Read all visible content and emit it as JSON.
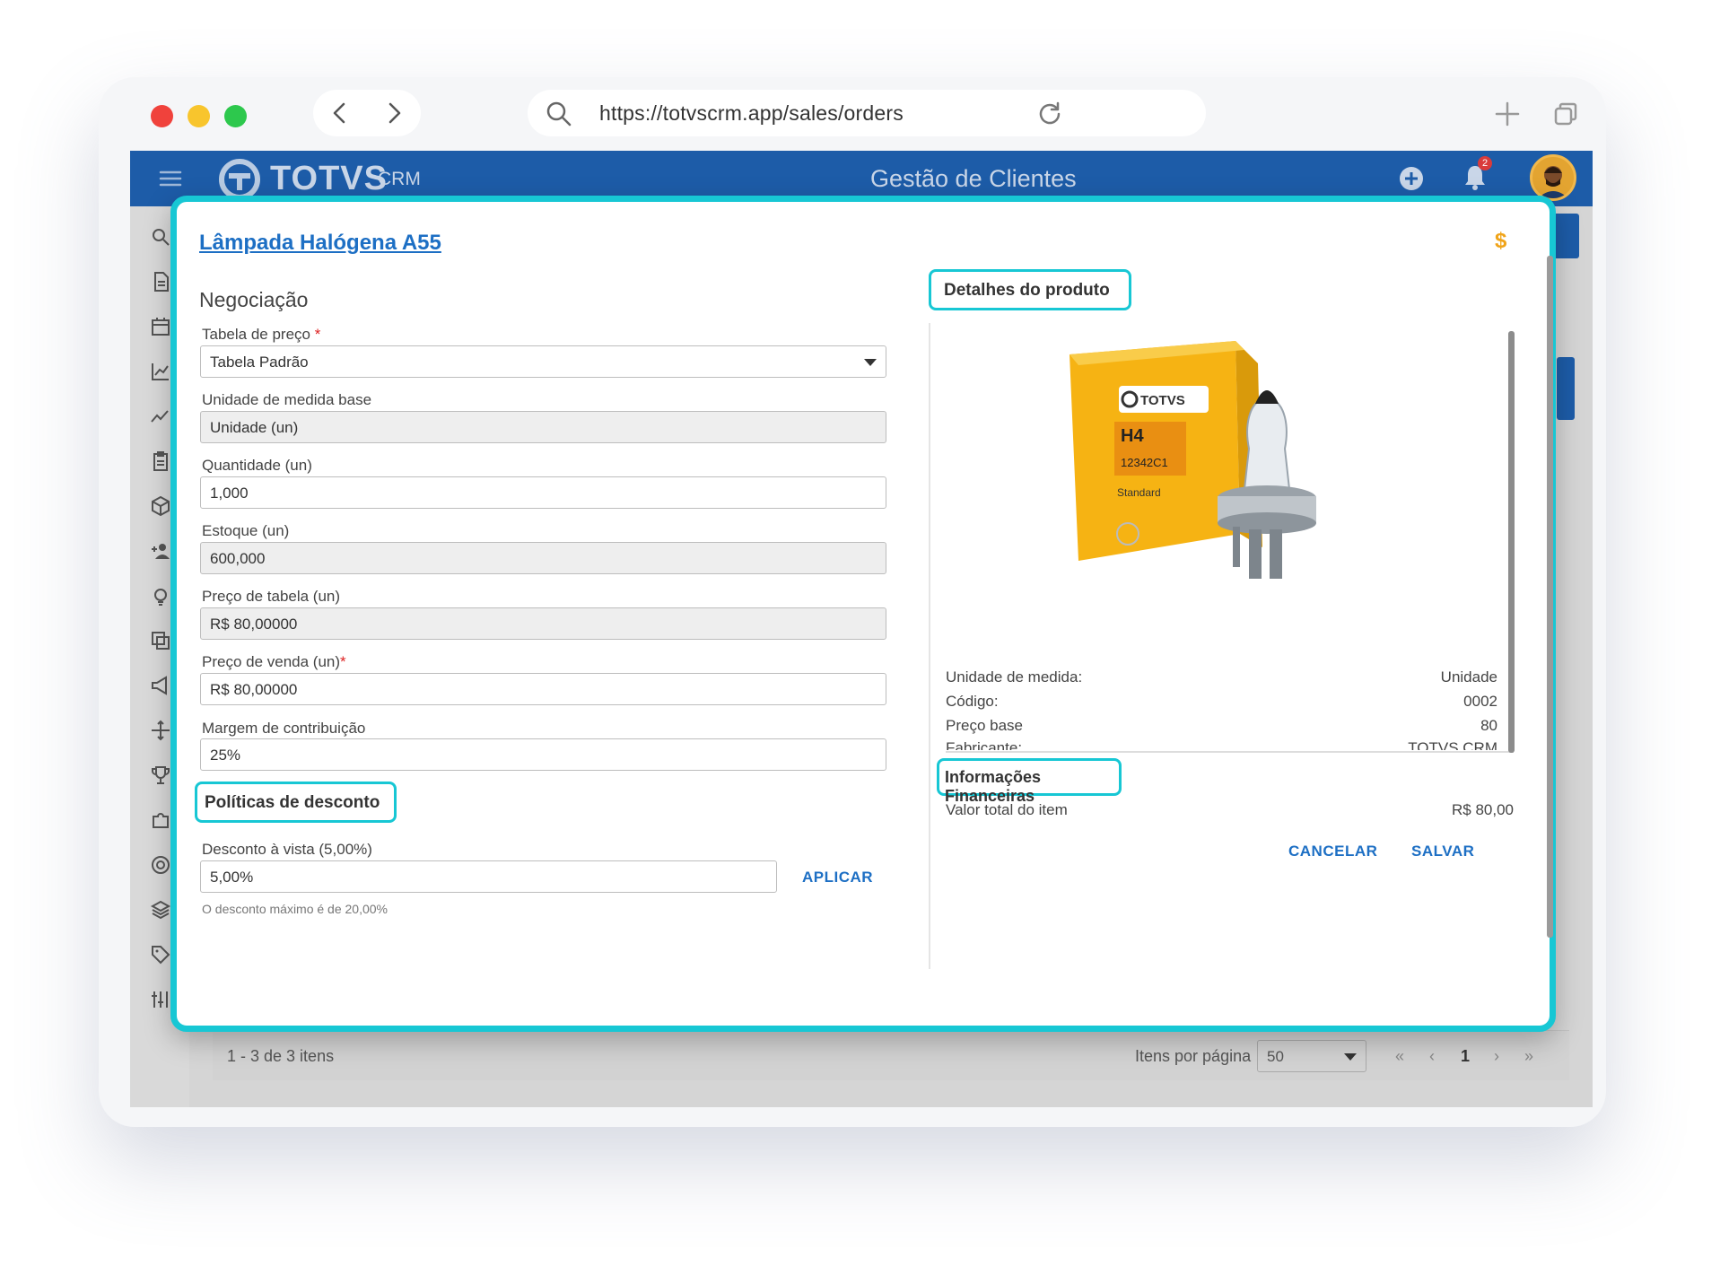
{
  "browser": {
    "url": "https://totvscrm.app/sales/orders",
    "traffic_colors": [
      "#f0423c",
      "#f8c52d",
      "#2dc84d"
    ]
  },
  "app": {
    "logo_text": "TOTVS",
    "logo_suffix": "CRM",
    "header_title": "Gestão de Clientes",
    "notification_count": "2",
    "brand_color": "#1d5ca8",
    "highlight_color": "#17c7d4"
  },
  "sidebar": {
    "icons": [
      "search-icon",
      "document-icon",
      "calendar-icon",
      "chart-icon",
      "trend-icon",
      "clipboard-icon",
      "box-icon",
      "add-user-icon",
      "lightbulb-icon",
      "copy-icon",
      "megaphone-icon",
      "move-icon",
      "trophy-icon",
      "puzzle-icon",
      "target-icon",
      "layers-icon",
      "tag-icon",
      "settings-icon"
    ]
  },
  "pagination": {
    "range": "1 - 3 de 3 itens",
    "per_page_label": "Itens por página",
    "per_page_value": "50",
    "first": "«",
    "prev": "‹",
    "page": "1",
    "next": "›",
    "last": "»"
  },
  "modal": {
    "title": "Lâmpada Halógena A55",
    "currency_icon": "$",
    "section_title": "Negociação",
    "fields": {
      "price_table": {
        "label": "Tabela de preço",
        "required": "*",
        "value": "Tabela Padrão"
      },
      "base_unit": {
        "label": "Unidade de medida base",
        "value": "Unidade (un)"
      },
      "quantity": {
        "label": "Quantidade (un)",
        "value": "1,000"
      },
      "stock": {
        "label": "Estoque (un)",
        "value": "600,000"
      },
      "list_price": {
        "label": "Preço de tabela (un)",
        "value": "R$ 80,00000"
      },
      "sale_price": {
        "label": "Preço de venda (un)",
        "required": "*",
        "value": "R$ 80,00000"
      },
      "margin": {
        "label": "Margem de contribuição",
        "value": "25%"
      }
    },
    "discount": {
      "title": "Políticas de desconto",
      "label": "Desconto à vista (5,00%)",
      "value": "5,00%",
      "apply": "APLICAR",
      "hint": "O desconto máximo é de 20,00%"
    },
    "product": {
      "title": "Detalhes do produto",
      "box_brand": "TOTVS",
      "box_model": "H4",
      "box_code": "12342C1",
      "box_line": "Standard",
      "details": [
        {
          "label": "Unidade de medida:",
          "value": "Unidade"
        },
        {
          "label": "Código:",
          "value": "0002"
        },
        {
          "label": "Preço base",
          "value": "80"
        },
        {
          "label": "Fabricante:",
          "value": "TOTVS CRM"
        }
      ]
    },
    "financial": {
      "title": "Informações Financeiras",
      "label": "Valor total do item",
      "value": "R$ 80,00"
    },
    "cancel": "CANCELAR",
    "save": "SALVAR"
  }
}
